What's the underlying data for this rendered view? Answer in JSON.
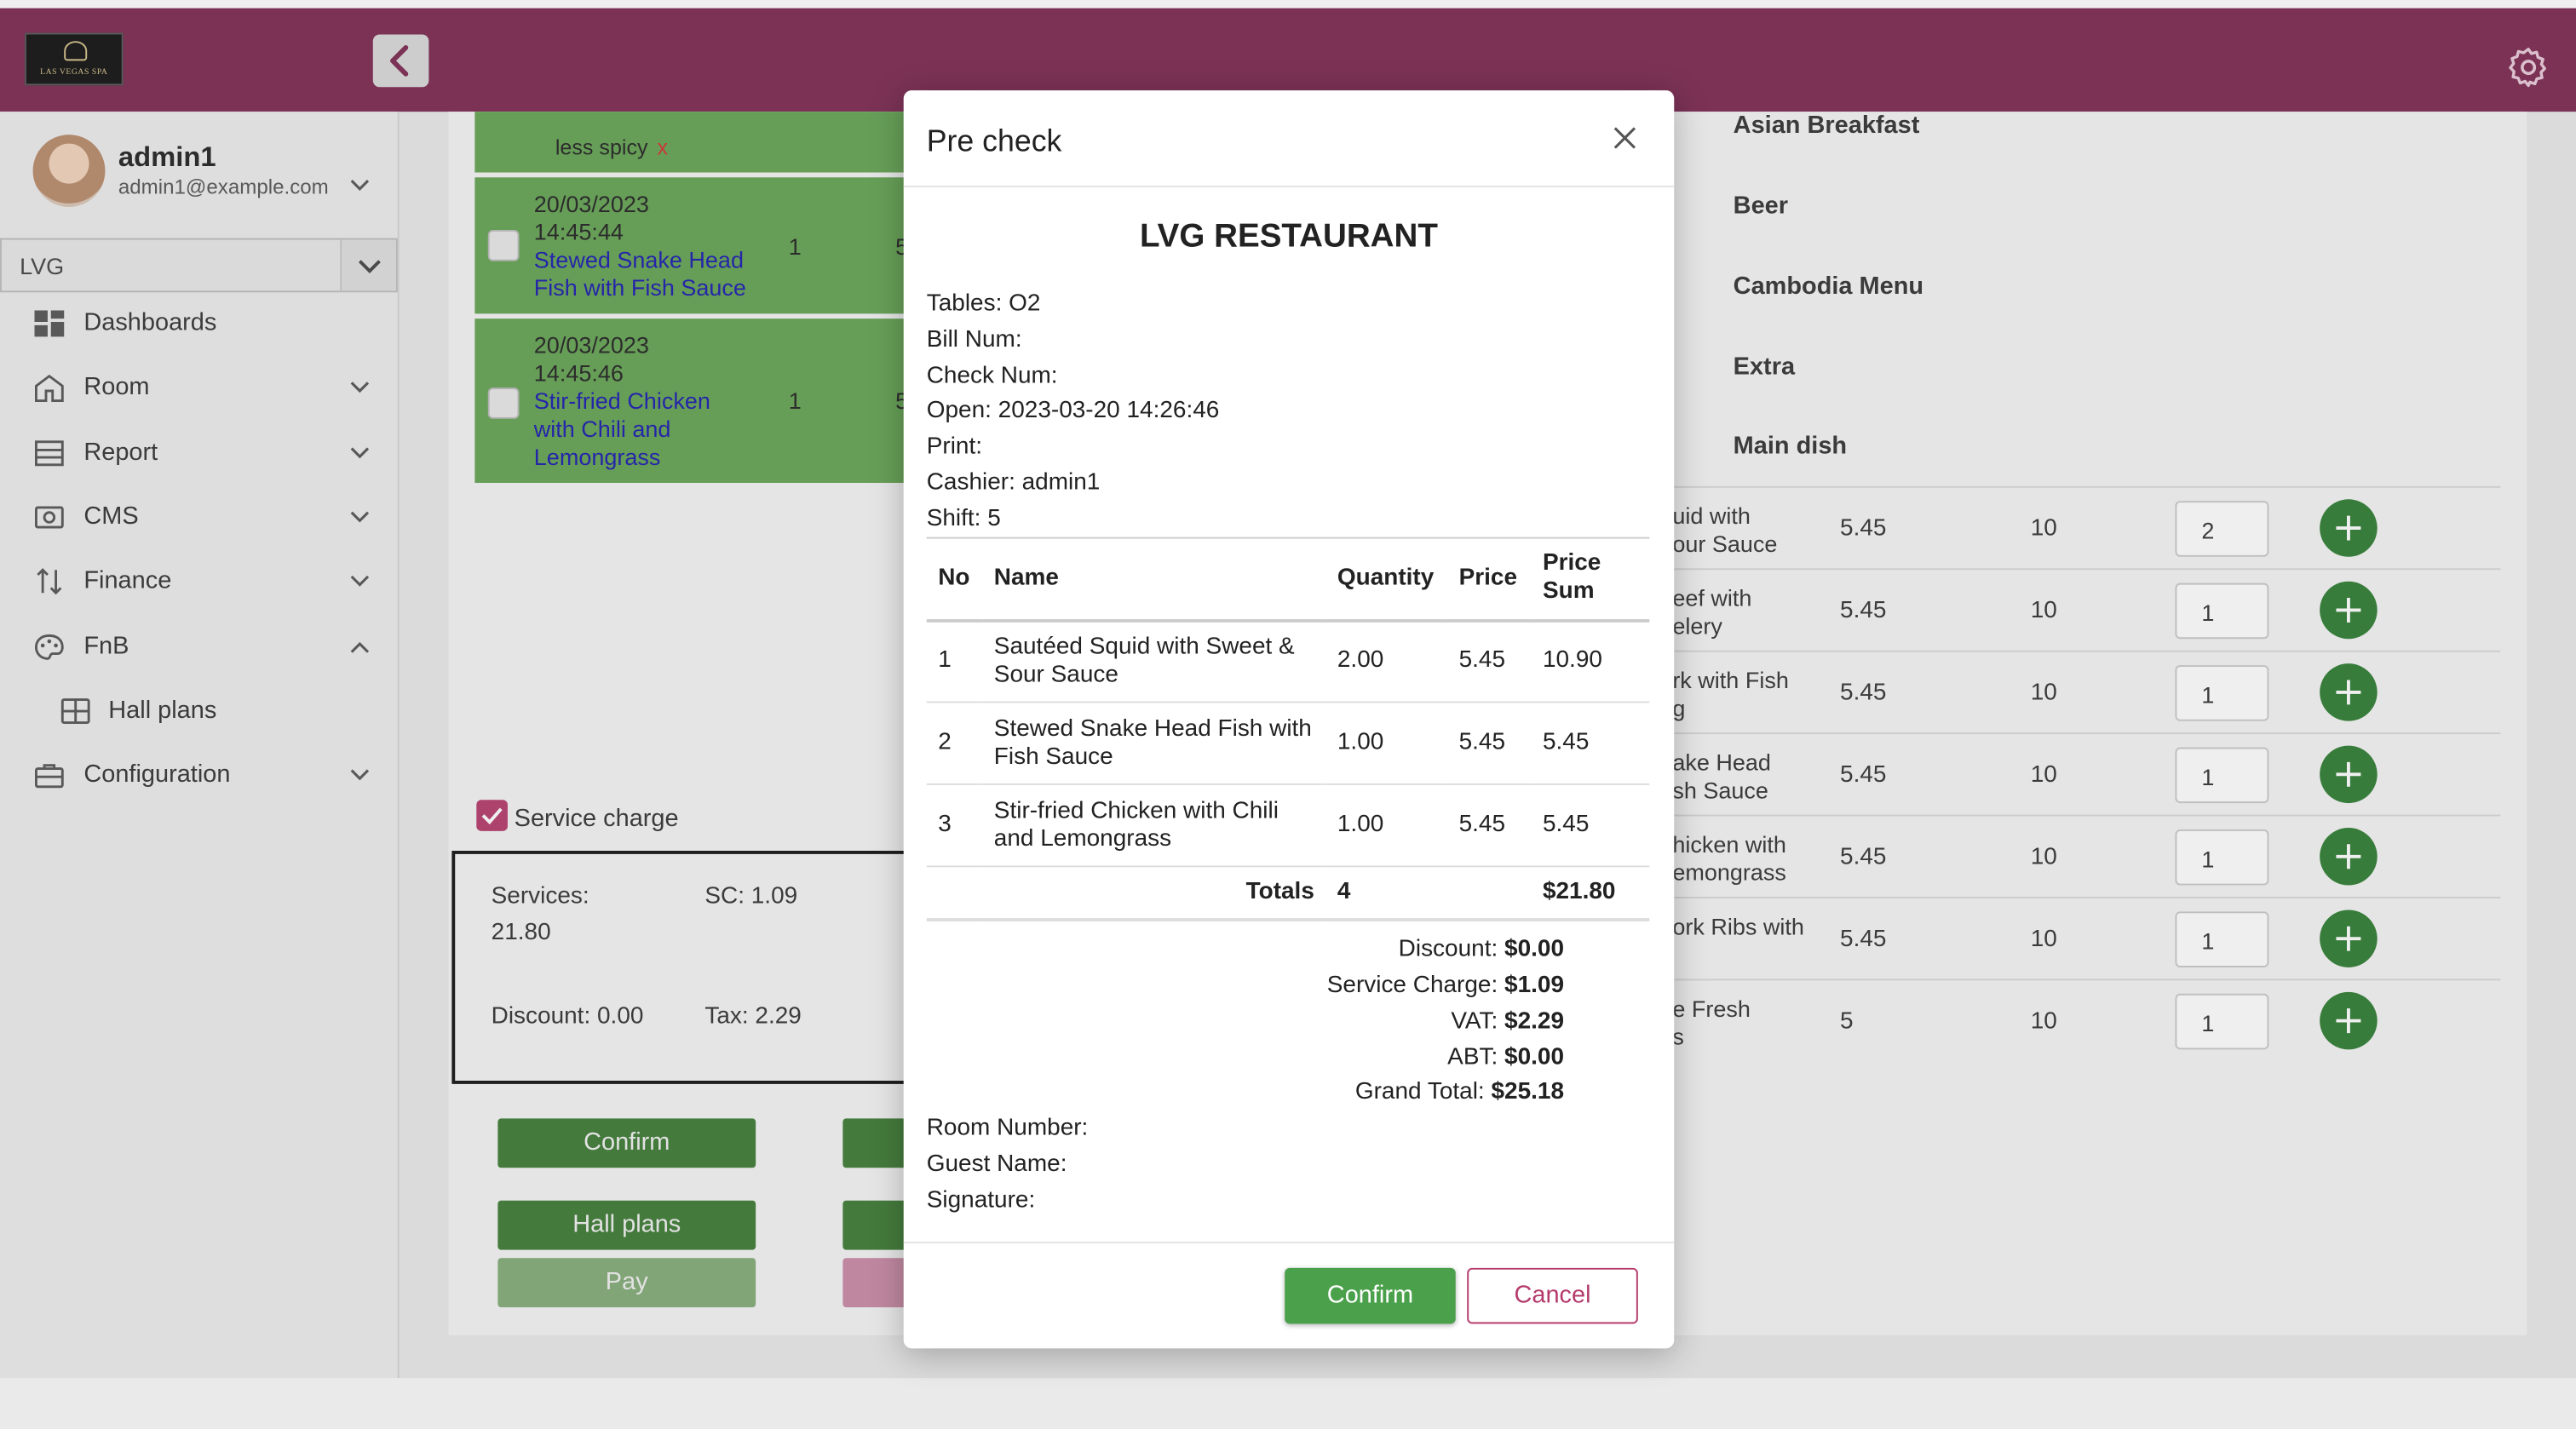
{
  "header": {
    "logo_text": "LAS VEGAS SPA",
    "colors": {
      "brand": "#7b2850",
      "accent_green": "#3d7a34",
      "pink": "#b43b6c"
    }
  },
  "user": {
    "name": "admin1",
    "email": "admin1@example.com"
  },
  "branch_select": {
    "value": "LVG"
  },
  "sidebar": {
    "items": [
      {
        "label": "Dashboards",
        "icon": "dashboard-icon"
      },
      {
        "label": "Room",
        "icon": "home-icon"
      },
      {
        "label": "Report",
        "icon": "report-icon"
      },
      {
        "label": "CMS",
        "icon": "cms-icon"
      },
      {
        "label": "Finance",
        "icon": "sort-arrows-icon"
      },
      {
        "label": "FnB",
        "icon": "palette-icon"
      },
      {
        "label": "Hall plans",
        "icon": "grid-icon"
      },
      {
        "label": "Configuration",
        "icon": "briefcase-icon"
      }
    ]
  },
  "order": {
    "note": "less spicy",
    "note_remove": "x",
    "items": [
      {
        "date": "20/03/2023",
        "time": "14:45:44",
        "name": "Stewed Snake Head Fish with Fish Sauce",
        "qty": "1",
        "cut": "5"
      },
      {
        "date": "20/03/2023",
        "time": "14:45:46",
        "name": "Stir-fried Chicken with Chili and Lemongrass",
        "qty": "1",
        "cut": "5"
      }
    ],
    "service_charge_label": "Service charge",
    "summary": {
      "services_label": "Services:",
      "services_value": "21.80",
      "sc": "SC: 1.09",
      "discount": "Discount: 0.00",
      "tax": "Tax: 2.29"
    },
    "buttons": {
      "confirm": "Confirm",
      "hall_plans": "Hall plans",
      "pay": "Pay"
    }
  },
  "categories": [
    "Asian Breakfast",
    "Beer",
    "Cambodia Menu",
    "Extra",
    "Main dish"
  ],
  "menu_items": [
    {
      "name": "uid with\nour Sauce",
      "price": "5.45",
      "time": "10",
      "qty": "2"
    },
    {
      "name": "eef with\nelery",
      "price": "5.45",
      "time": "10",
      "qty": "1"
    },
    {
      "name": "rk with Fish\ng",
      "price": "5.45",
      "time": "10",
      "qty": "1"
    },
    {
      "name": "ake Head\nsh Sauce",
      "price": "5.45",
      "time": "10",
      "qty": "1"
    },
    {
      "name": "hicken with\nemongrass",
      "price": "5.45",
      "time": "10",
      "qty": "1"
    },
    {
      "name": "ork Ribs with",
      "price": "5.45",
      "time": "10",
      "qty": "1"
    },
    {
      "name": "e Fresh\ns",
      "price": "5",
      "time": "10",
      "qty": "1"
    }
  ],
  "modal": {
    "title": "Pre check",
    "restaurant": "LVG RESTAURANT",
    "info": {
      "tables": "Tables: O2",
      "bill_num": "Bill Num:",
      "check_num": "Check Num:",
      "open": "Open: 2023-03-20 14:26:46",
      "print": "Print:",
      "cashier": "Cashier: admin1",
      "shift": "Shift: 5"
    },
    "table_headers": {
      "no": "No",
      "name": "Name",
      "quantity": "Quantity",
      "price": "Price",
      "price_sum": "Price Sum"
    },
    "rows": [
      {
        "no": "1",
        "name": "Sautéed Squid with Sweet & Sour Sauce",
        "quantity": "2.00",
        "price": "5.45",
        "sum": "10.90"
      },
      {
        "no": "2",
        "name": "Stewed Snake Head Fish with Fish Sauce",
        "quantity": "1.00",
        "price": "5.45",
        "sum": "5.45"
      },
      {
        "no": "3",
        "name": "Stir-fried Chicken with Chili and Lemongrass",
        "quantity": "1.00",
        "price": "5.45",
        "sum": "5.45"
      }
    ],
    "totals": {
      "label": "Totals",
      "quantity": "4",
      "sum": "$21.80"
    },
    "summary": {
      "discount_label": "Discount:",
      "discount": "$0.00",
      "service_label": "Service Charge:",
      "service": "$1.09",
      "vat_label": "VAT:",
      "vat": "$2.29",
      "abt_label": "ABT:",
      "abt": "$0.00",
      "grand_label": "Grand Total:",
      "grand": "$25.18"
    },
    "footer_fields": {
      "room": "Room Number:",
      "guest": "Guest Name:",
      "signature": "Signature:"
    },
    "confirm": "Confirm",
    "cancel": "Cancel"
  }
}
